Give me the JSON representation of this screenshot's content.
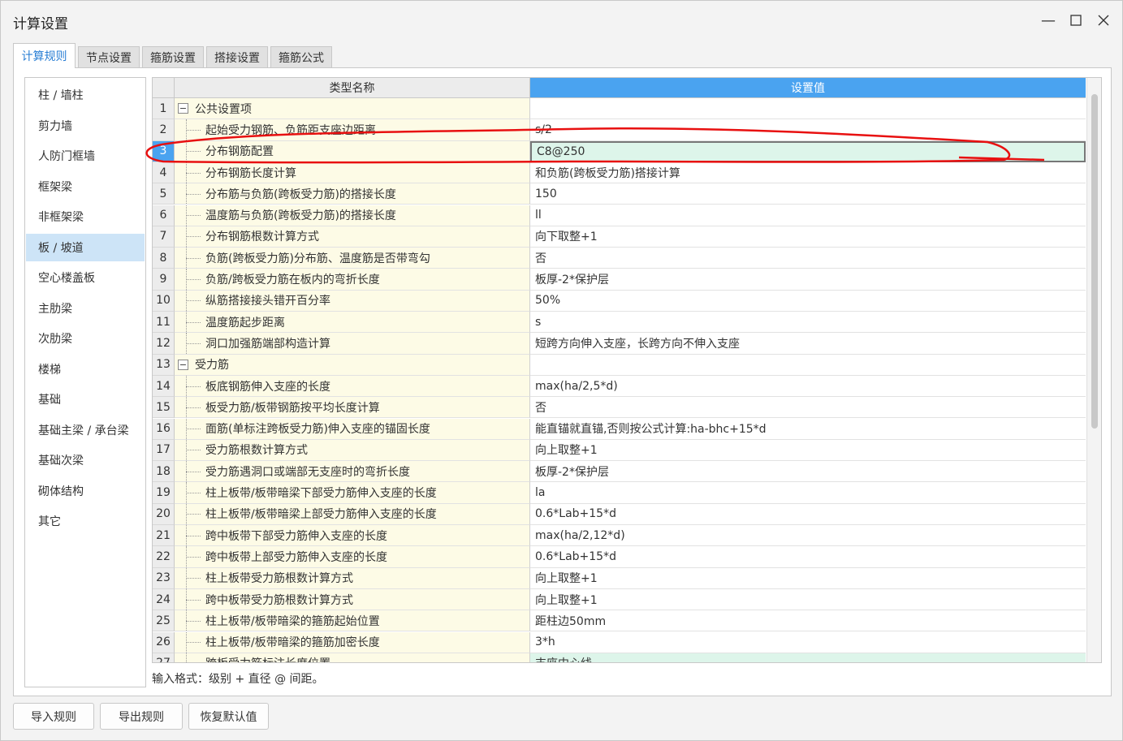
{
  "window": {
    "title": "计算设置",
    "min_glyph": "—",
    "max_glyph": "☐",
    "close_glyph": "✕"
  },
  "tabs": [
    {
      "label": "计算规则",
      "active": true
    },
    {
      "label": "节点设置",
      "active": false
    },
    {
      "label": "箍筋设置",
      "active": false
    },
    {
      "label": "搭接设置",
      "active": false
    },
    {
      "label": "箍筋公式",
      "active": false
    }
  ],
  "sidebar": {
    "items": [
      {
        "label": "柱 / 墙柱"
      },
      {
        "label": "剪力墙"
      },
      {
        "label": "人防门框墙"
      },
      {
        "label": "框架梁"
      },
      {
        "label": "非框架梁"
      },
      {
        "label": "板 / 坡道",
        "active": true
      },
      {
        "label": "空心楼盖板"
      },
      {
        "label": "主肋梁"
      },
      {
        "label": "次肋梁"
      },
      {
        "label": "楼梯"
      },
      {
        "label": "基础"
      },
      {
        "label": "基础主梁 / 承台梁"
      },
      {
        "label": "基础次梁"
      },
      {
        "label": "砌体结构"
      },
      {
        "label": "其它"
      }
    ]
  },
  "grid": {
    "headers": {
      "name": "类型名称",
      "value": "设置值"
    },
    "rows": [
      {
        "num": "1",
        "name": "公共设置项",
        "value": "",
        "group": true
      },
      {
        "num": "2",
        "name": "起始受力钢筋、负筋距支座边距离",
        "value": "s/2"
      },
      {
        "num": "3",
        "name": "分布钢筋配置",
        "value": "C8@250",
        "selected": true
      },
      {
        "num": "4",
        "name": "分布钢筋长度计算",
        "value": "和负筋(跨板受力筋)搭接计算"
      },
      {
        "num": "5",
        "name": "分布筋与负筋(跨板受力筋)的搭接长度",
        "value": "150"
      },
      {
        "num": "6",
        "name": "温度筋与负筋(跨板受力筋)的搭接长度",
        "value": "ll"
      },
      {
        "num": "7",
        "name": "分布钢筋根数计算方式",
        "value": "向下取整+1"
      },
      {
        "num": "8",
        "name": "负筋(跨板受力筋)分布筋、温度筋是否带弯勾",
        "value": "否"
      },
      {
        "num": "9",
        "name": "负筋/跨板受力筋在板内的弯折长度",
        "value": "板厚-2*保护层"
      },
      {
        "num": "10",
        "name": "纵筋搭接接头错开百分率",
        "value": "50%"
      },
      {
        "num": "11",
        "name": "温度筋起步距离",
        "value": "s"
      },
      {
        "num": "12",
        "name": "洞口加强筋端部构造计算",
        "value": "短跨方向伸入支座，长跨方向不伸入支座"
      },
      {
        "num": "13",
        "name": "受力筋",
        "value": "",
        "group": true
      },
      {
        "num": "14",
        "name": "板底钢筋伸入支座的长度",
        "value": "max(ha/2,5*d)"
      },
      {
        "num": "15",
        "name": "板受力筋/板带钢筋按平均长度计算",
        "value": "否"
      },
      {
        "num": "16",
        "name": "面筋(单标注跨板受力筋)伸入支座的锚固长度",
        "value": "能直锚就直锚,否则按公式计算:ha-bhc+15*d"
      },
      {
        "num": "17",
        "name": "受力筋根数计算方式",
        "value": "向上取整+1"
      },
      {
        "num": "18",
        "name": "受力筋遇洞口或端部无支座时的弯折长度",
        "value": "板厚-2*保护层"
      },
      {
        "num": "19",
        "name": "柱上板带/板带暗梁下部受力筋伸入支座的长度",
        "value": "la"
      },
      {
        "num": "20",
        "name": "柱上板带/板带暗梁上部受力筋伸入支座的长度",
        "value": "0.6*Lab+15*d"
      },
      {
        "num": "21",
        "name": "跨中板带下部受力筋伸入支座的长度",
        "value": "max(ha/2,12*d)"
      },
      {
        "num": "22",
        "name": "跨中板带上部受力筋伸入支座的长度",
        "value": "0.6*Lab+15*d"
      },
      {
        "num": "23",
        "name": "柱上板带受力筋根数计算方式",
        "value": "向上取整+1"
      },
      {
        "num": "24",
        "name": "跨中板带受力筋根数计算方式",
        "value": "向上取整+1"
      },
      {
        "num": "25",
        "name": "柱上板带/板带暗梁的箍筋起始位置",
        "value": "距柱边50mm"
      },
      {
        "num": "26",
        "name": "柱上板带/板带暗梁的箍筋加密长度",
        "value": "3*h"
      },
      {
        "num": "27",
        "name": "跨板受力筋标注长度位置",
        "value": "支座中心线",
        "last": true
      }
    ]
  },
  "hint": "输入格式：级别 + 直径 @ 间距。",
  "footer": {
    "import_label": "导入规则",
    "export_label": "导出规则",
    "restore_label": "恢复默认值"
  },
  "colors": {
    "accent": "#4aa3f0",
    "selected_value_bg": "#ddf5ea",
    "annotation": "#e81010"
  }
}
